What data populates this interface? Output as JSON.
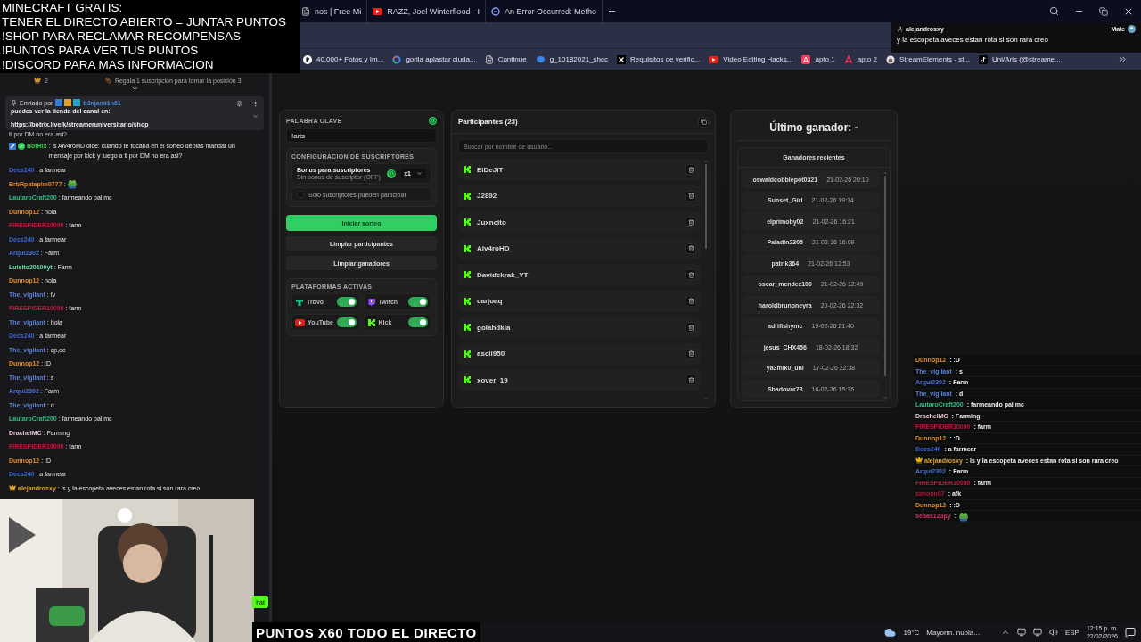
{
  "browser": {
    "tabs": [
      {
        "title": "nos | Free Mi",
        "kind": "doc"
      },
      {
        "title": "RAZZ, Joel Winterflood - I",
        "kind": "youtube"
      },
      {
        "title": "An Error Occurred: Metho",
        "kind": "error"
      }
    ],
    "bookmarks": [
      {
        "title": "40.000+ Fotos y Im...",
        "kind": "pexels"
      },
      {
        "title": "gorila aplastar ciuda...",
        "kind": "google"
      },
      {
        "title": "Continue",
        "kind": "doc"
      },
      {
        "title": "g_10182021_shcc",
        "kind": "chat"
      },
      {
        "title": "Requisitos de verific...",
        "kind": "x"
      },
      {
        "title": "Video Editing Hacks...",
        "kind": "youtube"
      },
      {
        "title": "apto 1",
        "kind": "airbnb"
      },
      {
        "title": "apto 2",
        "kind": "airbnb_outline"
      },
      {
        "title": "StreamElements - st...",
        "kind": "se"
      },
      {
        "title": "Uni/Aris (@streame...",
        "kind": "tiktok"
      }
    ]
  },
  "overlay_rules": {
    "lines": [
      "MINECRAFT GRATIS:",
      "TENER EL DIRECTO ABIERTO = JUNTAR PUNTOS",
      "!SHOP PARA RECLAMAR RECOMPENSAS",
      "!PUNTOS PARA VER TUS PUNTOS",
      "!DISCORD PARA MAS INFORMACION"
    ]
  },
  "notification": {
    "user": "alejandrosxy",
    "badge": "Male",
    "message": "y la escopeta aveces estan rota si son rara creo"
  },
  "chat": {
    "gift_count": "2",
    "gift_prompt": "Regala 1 suscripción para tomar la posición 3",
    "pinned": {
      "label": "Enviado por",
      "user": "b3njami1n61",
      "message": "puedes ver la tienda del canal en:",
      "link": "https://botrix.live/k/streameruniversitario/shop"
    },
    "cut_line": "ti por DM no era asi?",
    "messages": [
      {
        "kind": "bot",
        "user": "BotRix",
        "color": "#3ccf4e",
        "text": ": ls Alv4roHD dice: cuando te tocaba en el sorteo debias mandar un mensaje por kick y luego a ti por DM no era asi?"
      },
      {
        "kind": "plain",
        "user": "Decs240",
        "color": "#3a64d8",
        "text": ": a farmear"
      },
      {
        "kind": "emote",
        "user": "BrbRpatapim0777",
        "color": "#e0842a",
        "text": ":"
      },
      {
        "kind": "plain",
        "user": "LautaroCraft200",
        "color": "#2fbf84",
        "text": ": farmeando pal mc"
      },
      {
        "kind": "plain",
        "user": "Dunnop12",
        "color": "#e08c2c",
        "text": ": hola"
      },
      {
        "kind": "plain",
        "user": "FIRESPIDER10090",
        "color": "#c8153f",
        "text": ": farm"
      },
      {
        "kind": "plain",
        "user": "Decs240",
        "color": "#3a64d8",
        "text": ": a farmear"
      },
      {
        "kind": "plain",
        "user": "Arqui2302",
        "color": "#4a6ed0",
        "text": ": Farm"
      },
      {
        "kind": "plain",
        "user": "Luisito20100yt",
        "color": "#62e0a8",
        "text": ": Farm"
      },
      {
        "kind": "plain",
        "user": "Dunnop12",
        "color": "#e08c2c",
        "text": ": hola"
      },
      {
        "kind": "plain",
        "user": "The_vigilant",
        "color": "#5b80d4",
        "text": ": fv"
      },
      {
        "kind": "plain",
        "user": "FIRESPIDER10090",
        "color": "#c8153f",
        "text": ": farm"
      },
      {
        "kind": "plain",
        "user": "The_vigilant",
        "color": "#5b80d4",
        "text": ": hola"
      },
      {
        "kind": "plain",
        "user": "Decs240",
        "color": "#3a64d8",
        "text": ": a farmear"
      },
      {
        "kind": "plain",
        "user": "The_vigilant",
        "color": "#5b80d4",
        "text": ": cp,oc"
      },
      {
        "kind": "plain",
        "user": "Dunnop12",
        "color": "#e08c2c",
        "text": ": :D"
      },
      {
        "kind": "plain",
        "user": "The_vigilant",
        "color": "#5b80d4",
        "text": ": s"
      },
      {
        "kind": "plain",
        "user": "Arqui2302",
        "color": "#4a6ed0",
        "text": ": Farm"
      },
      {
        "kind": "plain",
        "user": "The_vigilant",
        "color": "#5b80d4",
        "text": ": d"
      },
      {
        "kind": "plain",
        "user": "LautaroCraft200",
        "color": "#2fbf84",
        "text": ": farmeando pal mc"
      },
      {
        "kind": "plain",
        "user": "DrachelMC",
        "color": "#e6c8d6",
        "text": ": Farming"
      },
      {
        "kind": "plain",
        "user": "FIRESPIDER10090",
        "color": "#c8153f",
        "text": ": farm"
      },
      {
        "kind": "plain",
        "user": "Dunnop12",
        "color": "#e08c2c",
        "text": ": :D"
      },
      {
        "kind": "plain",
        "user": "Decs240",
        "color": "#3a64d8",
        "text": ": a farmear"
      },
      {
        "kind": "sub",
        "user": "alejandrosxy",
        "color": "#e0a030",
        "text": ": ls y la escopeta aveces estan rota si son rara creo"
      }
    ]
  },
  "giveaway": {
    "keyword": {
      "label": "PALABRA CLAVE",
      "value": "!aris"
    },
    "subscribers": {
      "title": "CONFIGURACIÓN DE SUSCRIPTORES",
      "bonus_title": "Bonus para suscriptores",
      "bonus_status": "Sin bonus de suscriptor (OFF)",
      "multiplier": "x1",
      "only_subs_label": "Solo suscriptores pueden participar",
      "only_subs_checked": false
    },
    "actions": [
      {
        "label": "Iniciar sorteo",
        "kind": "primary"
      },
      {
        "label": "Limpiar participantes",
        "kind": "secondary"
      },
      {
        "label": "Limpiar ganadores",
        "kind": "secondary"
      }
    ],
    "platforms": {
      "title": "PLATAFORMAS ACTIVAS",
      "items": [
        {
          "name": "Trovo",
          "kind": "trovo",
          "on": true
        },
        {
          "name": "Twitch",
          "kind": "twitch",
          "on": true
        },
        {
          "name": "YouTube",
          "kind": "youtube",
          "on": true
        },
        {
          "name": "Kick",
          "kind": "kick",
          "on": true
        }
      ]
    },
    "participants": {
      "title": "Participantes (23)",
      "search_placeholder": "Buscar por nombre de usuario...",
      "items": [
        {
          "name": "ElDeJiT",
          "kind": "kick"
        },
        {
          "name": "J2892",
          "kind": "kick"
        },
        {
          "name": "Juxncito",
          "kind": "kick"
        },
        {
          "name": "Alv4roHD",
          "kind": "kick"
        },
        {
          "name": "Davidckrak_YT",
          "kind": "kick"
        },
        {
          "name": "carjoaq",
          "kind": "kick"
        },
        {
          "name": "golahdkla",
          "kind": "kick"
        },
        {
          "name": "ascii950",
          "kind": "kick"
        },
        {
          "name": "xover_19",
          "kind": "kick"
        }
      ]
    },
    "winners": {
      "last_winner": "Último ganador: -",
      "recent_title": "Ganadores recientes",
      "items": [
        {
          "name": "oswaldcobblepot0321",
          "date": "21-02-26 20:10"
        },
        {
          "name": "Sunset_Girl",
          "date": "21-02-26 19:34"
        },
        {
          "name": "elprimoby02",
          "date": "21-02-26 16:21"
        },
        {
          "name": "Paladin2305",
          "date": "21-02-26 16:09"
        },
        {
          "name": "patrik364",
          "date": "21-02-26 12:53"
        },
        {
          "name": "oscar_mendez100",
          "date": "21-02-26 12:49"
        },
        {
          "name": "haroldbrunoneyra",
          "date": "20-02-26 22:32"
        },
        {
          "name": "adrifishymc",
          "date": "19-02-26 21:40"
        },
        {
          "name": "jesus_CHX456",
          "date": "18-02-26 18:32"
        },
        {
          "name": "ya3mik0_uni",
          "date": "17-02-26 22:38"
        },
        {
          "name": "Shadovar73",
          "date": "16-02-26 15:36"
        }
      ]
    }
  },
  "overlay_chat": [
    {
      "kind": "plain",
      "user": "Dunnop12",
      "color": "#e08c2c",
      "text": ": :D"
    },
    {
      "kind": "plain",
      "user": "The_vigilant",
      "color": "#5b80d4",
      "text": ": s"
    },
    {
      "kind": "plain",
      "user": "Arqui2302",
      "color": "#4a6ed0",
      "text": ": Farm"
    },
    {
      "kind": "plain",
      "user": "The_vigilant",
      "color": "#5b80d4",
      "text": ": d"
    },
    {
      "kind": "plain",
      "user": "LautaroCraft200",
      "color": "#2fbf84",
      "text": ": farmeando pal mc"
    },
    {
      "kind": "plain",
      "user": "DrachelMC",
      "color": "#e6c8d6",
      "text": ": Farming"
    },
    {
      "kind": "plain",
      "user": "FIRESPIDER10090",
      "color": "#c8153f",
      "text": ": farm"
    },
    {
      "kind": "plain",
      "user": "Dunnop12",
      "color": "#e08c2c",
      "text": ": :D"
    },
    {
      "kind": "plain",
      "user": "Decs240",
      "color": "#3a64d8",
      "text": ": a farmear"
    },
    {
      "kind": "sub",
      "user": "alejandrosxy",
      "color": "#e0a030",
      "text": ": ls y la escopeta aveces estan rota si son rara creo"
    },
    {
      "kind": "plain",
      "user": "Arqui2302",
      "color": "#4a6ed0",
      "text": ": Farm"
    },
    {
      "kind": "plain",
      "user": "FIRESPIDER10090",
      "color": "#c8153f",
      "text": ": farm"
    },
    {
      "kind": "plain",
      "user": "simoon07",
      "color": "#b01a3a",
      "text": ": afk"
    },
    {
      "kind": "plain",
      "user": "Dunnop12",
      "color": "#e08c2c",
      "text": ": :D"
    },
    {
      "kind": "emote",
      "user": "sebas123py",
      "color": "#d0306a",
      "text": ":"
    }
  ],
  "stream_overlay": {
    "banner": "PUNTOS X60 TODO EL DIRECTO",
    "chat_button": "hat"
  },
  "taskbar": {
    "temperature": "19°C",
    "weather": "Mayorm. nubla...",
    "language": "ESP",
    "time": "12:15 p. m.",
    "date": "22/02/2026"
  }
}
